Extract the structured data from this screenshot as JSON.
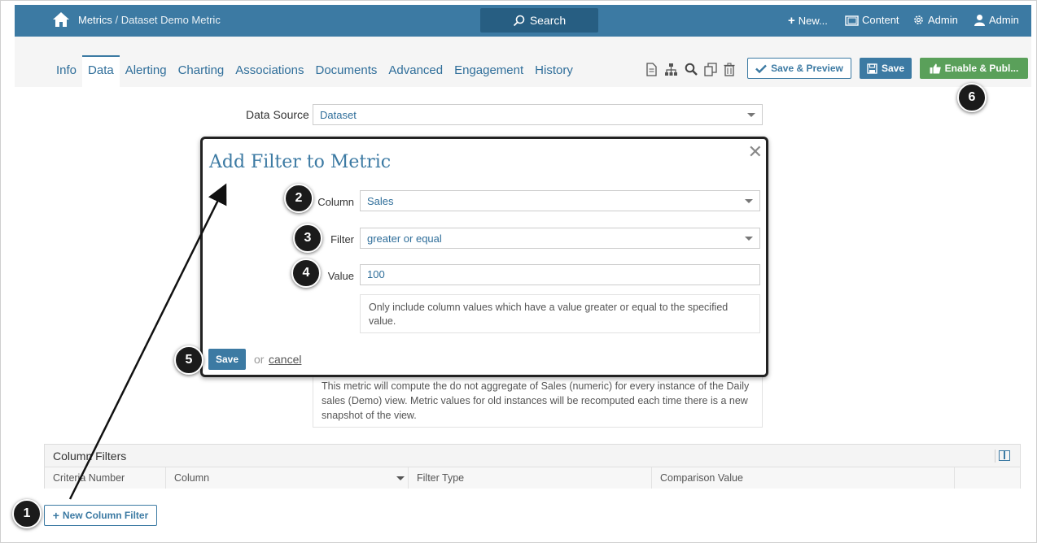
{
  "topbar": {
    "breadcrumb_root": "Metrics",
    "breadcrumb_sep": " / ",
    "breadcrumb_current": "Dataset Demo Metric",
    "search_label": "Search",
    "new_label": "New...",
    "content_label": "Content",
    "admin_label": "Admin",
    "user_label": "Admin"
  },
  "tabs": [
    "Info",
    "Data",
    "Alerting",
    "Charting",
    "Associations",
    "Documents",
    "Advanced",
    "Engagement",
    "History"
  ],
  "active_tab": "Data",
  "toolbar": {
    "save_preview_label": "Save & Preview",
    "save_label": "Save",
    "enable_label": "Enable & Publ..."
  },
  "data_source": {
    "label": "Data Source",
    "value": "Dataset"
  },
  "modal": {
    "title": "Add Filter to Metric",
    "column_label": "Column",
    "column_value": "Sales",
    "filter_label": "Filter",
    "filter_value": "greater or equal",
    "value_label": "Value",
    "value_value": "100",
    "help_text": "Only include column values which have a value greater or equal to the specified value.",
    "save_label": "Save",
    "or_text": "or",
    "cancel_label": "cancel"
  },
  "description": "This metric will compute the do not aggregate of Sales (numeric) for every instance of the Daily sales (Demo) view. Metric values for old instances will be recomputed each time there is a new snapshot of the view.",
  "column_filters": {
    "title": "Column Filters",
    "headers": [
      "Criteria Number",
      "Column",
      "Filter Type",
      "Comparison Value"
    ],
    "new_button_label": "New Column Filter"
  },
  "callouts": [
    "1",
    "2",
    "3",
    "4",
    "5",
    "6"
  ],
  "colors": {
    "brand": "#3c7aa3",
    "publish": "#5aa05a",
    "callout": "#1b1b1b"
  }
}
